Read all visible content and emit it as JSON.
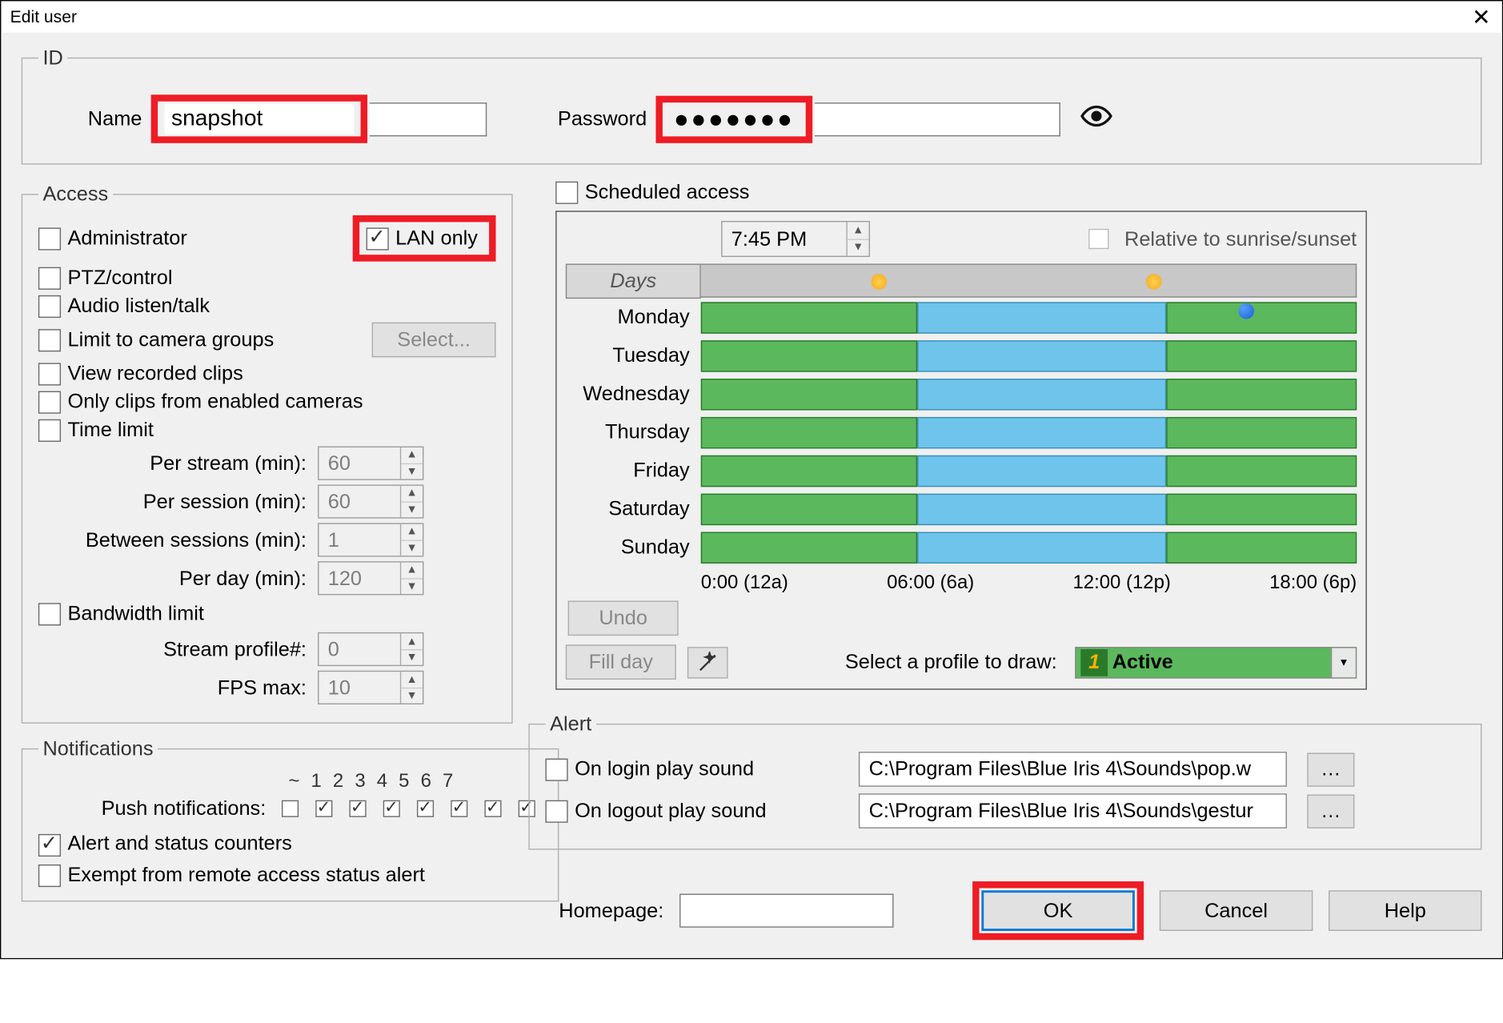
{
  "window": {
    "title": "Edit user"
  },
  "id": {
    "legend": "ID",
    "name_label": "Name",
    "name_value": "snapshot",
    "password_label": "Password",
    "password_mask": "●●●●●●●"
  },
  "access": {
    "legend": "Access",
    "admin": "Administrator",
    "lan_only": "LAN only",
    "ptz": "PTZ/control",
    "audio": "Audio listen/talk",
    "limit_groups": "Limit to camera groups",
    "select_btn": "Select...",
    "view_clips": "View recorded clips",
    "only_enabled": "Only clips from enabled cameras",
    "time_limit": "Time limit",
    "per_stream": "Per stream (min):",
    "per_stream_v": "60",
    "per_session": "Per session (min):",
    "per_session_v": "60",
    "between": "Between sessions (min):",
    "between_v": "1",
    "per_day": "Per day (min):",
    "per_day_v": "120",
    "bandwidth": "Bandwidth limit",
    "stream_profile": "Stream profile#:",
    "stream_profile_v": "0",
    "fps": "FPS max:",
    "fps_v": "10"
  },
  "notifications": {
    "legend": "Notifications",
    "push_label": "Push notifications:",
    "headers": [
      "~",
      "1",
      "2",
      "3",
      "4",
      "5",
      "6",
      "7"
    ],
    "checks": [
      false,
      true,
      true,
      true,
      true,
      true,
      true,
      true
    ],
    "alert_counters": "Alert and status counters",
    "exempt": "Exempt from remote access status alert"
  },
  "schedule": {
    "label": "Scheduled access",
    "time_value": "7:45 PM",
    "relative": "Relative to sunrise/sunset",
    "days_header": "Days",
    "days": [
      "Monday",
      "Tuesday",
      "Wednesday",
      "Thursday",
      "Friday",
      "Saturday",
      "Sunday"
    ],
    "axis": [
      "0:00 (12a)",
      "06:00 (6a)",
      "12:00 (12p)",
      "18:00 (6p)"
    ],
    "undo": "Undo",
    "fill_day": "Fill day",
    "select_profile": "Select a profile to draw:",
    "active": "Active"
  },
  "alert": {
    "legend": "Alert",
    "login": "On login play sound",
    "logout": "On logout play sound",
    "login_path": "C:\\Program Files\\Blue Iris 4\\Sounds\\pop.w",
    "logout_path": "C:\\Program Files\\Blue Iris 4\\Sounds\\gestur"
  },
  "bottom": {
    "homepage": "Homepage:",
    "ok": "OK",
    "cancel": "Cancel",
    "help": "Help"
  }
}
